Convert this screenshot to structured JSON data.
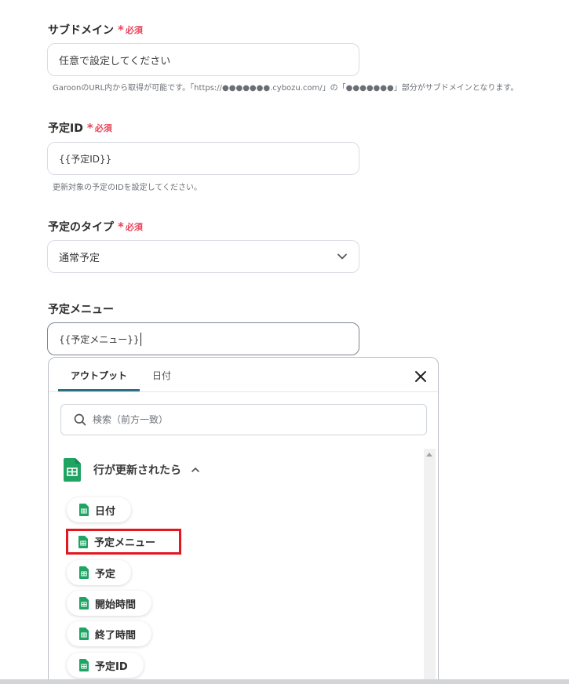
{
  "subdomain": {
    "label": "サブドメイン",
    "required_star": "*",
    "required_text": "必須",
    "placeholder": "任意で設定してください",
    "help": "GaroonのURL内から取得が可能です。「https://●●●●●●●.cybozu.com/」の「●●●●●●●」部分がサブドメインとなります。"
  },
  "event_id": {
    "label": "予定ID",
    "required_star": "*",
    "required_text": "必須",
    "value": "{{予定ID}}",
    "help": "更新対象の予定のIDを設定してください。"
  },
  "event_type": {
    "label": "予定のタイプ",
    "required_star": "*",
    "required_text": "必須",
    "selected": "通常予定"
  },
  "event_menu": {
    "label": "予定メニュー",
    "value": "{{予定メニュー}}"
  },
  "panel": {
    "tabs": [
      {
        "label": "アウトプット",
        "active": true
      },
      {
        "label": "日付",
        "active": false
      }
    ],
    "search_placeholder": "検索（前方一致）",
    "group_title": "行が更新されたら",
    "items": [
      {
        "label": "日付"
      },
      {
        "label": "予定メニュー",
        "highlighted": true
      },
      {
        "label": "予定"
      },
      {
        "label": "開始時間"
      },
      {
        "label": "終了時間"
      },
      {
        "label": "予定ID"
      }
    ]
  },
  "colors": {
    "required": "#e8455a",
    "sheets_green": "#1fa463",
    "highlight_box": "#e2171f",
    "active_tab_underline": "#2a6f82"
  },
  "icons": [
    "chevron-down-icon",
    "close-icon",
    "search-icon",
    "google-sheets-icon",
    "chevron-up-icon"
  ]
}
